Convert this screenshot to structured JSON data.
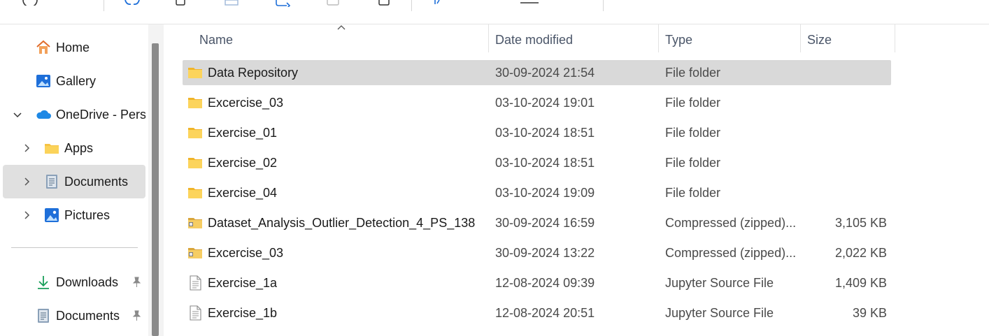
{
  "nav": {
    "home": "Home",
    "gallery": "Gallery",
    "onedrive": "OneDrive - Perso",
    "apps": "Apps",
    "documents": "Documents",
    "pictures": "Pictures",
    "pinned_downloads": "Downloads",
    "pinned_documents": "Documents"
  },
  "columns": {
    "name": "Name",
    "date": "Date modified",
    "type": "Type",
    "size": "Size"
  },
  "files": [
    {
      "name": "Data Repository",
      "date": "30-09-2024 21:54",
      "type": "File folder",
      "size": "",
      "icon": "folder-icon"
    },
    {
      "name": "Excercise_03",
      "date": "03-10-2024 19:01",
      "type": "File folder",
      "size": "",
      "icon": "folder-icon"
    },
    {
      "name": "Exercise_01",
      "date": "03-10-2024 18:51",
      "type": "File folder",
      "size": "",
      "icon": "folder-icon"
    },
    {
      "name": "Exercise_02",
      "date": "03-10-2024 18:51",
      "type": "File folder",
      "size": "",
      "icon": "folder-icon"
    },
    {
      "name": "Exercise_04",
      "date": "03-10-2024 19:09",
      "type": "File folder",
      "size": "",
      "icon": "folder-icon"
    },
    {
      "name": "Dataset_Analysis_Outlier_Detection_4_PS_138",
      "date": "30-09-2024 16:59",
      "type": "Compressed (zipped)...",
      "size": "3,105 KB",
      "icon": "zip-folder-icon"
    },
    {
      "name": "Excercise_03",
      "date": "30-09-2024 13:22",
      "type": "Compressed (zipped)...",
      "size": "2,022 KB",
      "icon": "zip-folder-icon"
    },
    {
      "name": "Exercise_1a",
      "date": "12-08-2024 09:39",
      "type": "Jupyter Source File",
      "size": "1,409 KB",
      "icon": "document-icon"
    },
    {
      "name": "Exercise_1b",
      "date": "12-08-2024 20:51",
      "type": "Jupyter Source File",
      "size": "39 KB",
      "icon": "document-icon"
    }
  ],
  "colors": {
    "selected_row": "#d9d9d9",
    "selected_nav": "#e0e0e0",
    "folder": "#f6c343",
    "onedrive": "#1e88e5"
  }
}
